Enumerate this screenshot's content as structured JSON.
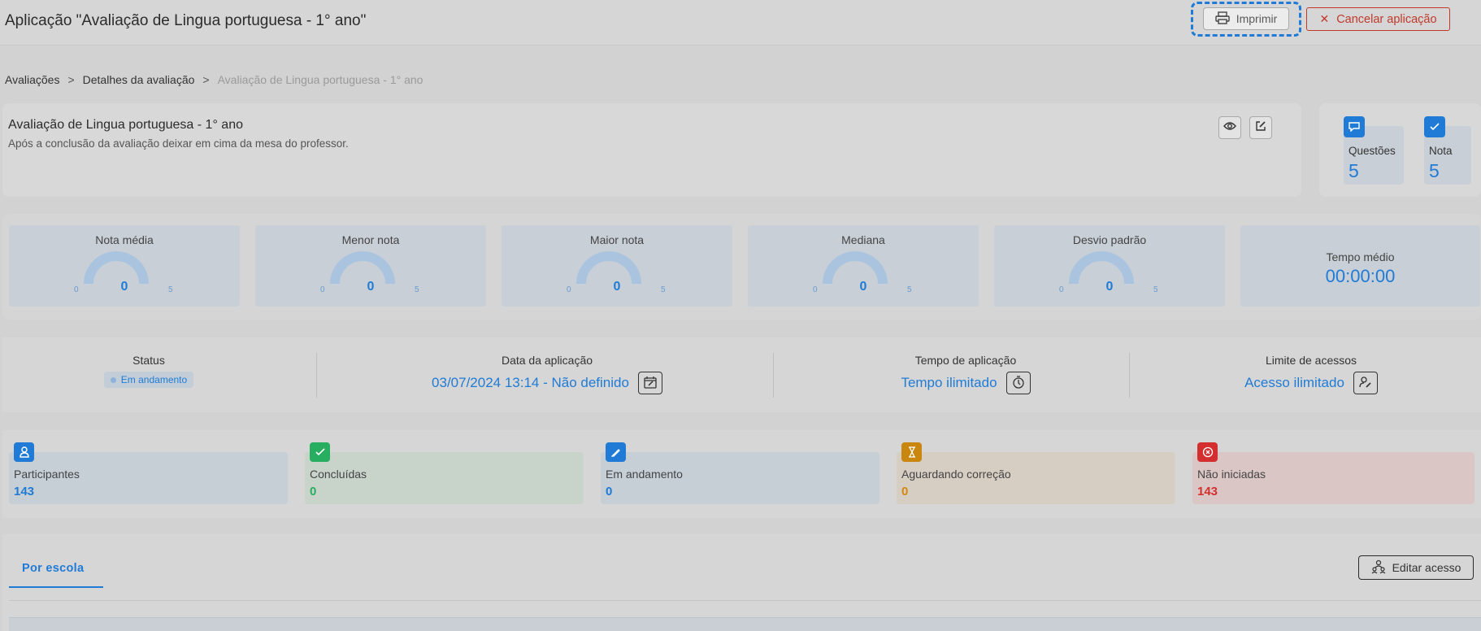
{
  "header": {
    "title": "Aplicação \"Avaliação de Lingua portuguesa - 1° ano\"",
    "print_label": "Imprimir",
    "cancel_label": "Cancelar aplicação"
  },
  "breadcrumb": {
    "items": [
      "Avaliações",
      "Detalhes da avaliação",
      "Avaliação de Lingua portuguesa - 1° ano"
    ]
  },
  "assessment": {
    "title": "Avaliação de Lingua portuguesa - 1° ano",
    "description": "Após a conclusão da avaliação deixar em cima da mesa do professor."
  },
  "summary": {
    "questions_label": "Questões",
    "questions_value": "5",
    "grade_label": "Nota",
    "grade_value": "5"
  },
  "gauges": [
    {
      "title": "Nota média",
      "value": "0",
      "min": "0",
      "max": "5"
    },
    {
      "title": "Menor nota",
      "value": "0",
      "min": "0",
      "max": "5"
    },
    {
      "title": "Maior nota",
      "value": "0",
      "min": "0",
      "max": "5"
    },
    {
      "title": "Mediana",
      "value": "0",
      "min": "0",
      "max": "5"
    },
    {
      "title": "Desvio padrão",
      "value": "0",
      "min": "0",
      "max": "5"
    }
  ],
  "average_time": {
    "title": "Tempo médio",
    "value": "00:00:00"
  },
  "status": {
    "status_title": "Status",
    "status_value": "Em andamento",
    "date_title": "Data da aplicação",
    "date_value": "03/07/2024 13:14 - Não definido",
    "time_title": "Tempo de aplicação",
    "time_value": "Tempo ilimitado",
    "access_title": "Limite de acessos",
    "access_value": "Acesso ilimitado"
  },
  "counts": [
    {
      "label": "Participantes",
      "value": "143",
      "color": "#1f7bd6"
    },
    {
      "label": "Concluídas",
      "value": "0",
      "color": "#27ae60"
    },
    {
      "label": "Em andamento",
      "value": "0",
      "color": "#1f7bd6"
    },
    {
      "label": "Aguardando correção",
      "value": "0",
      "color": "#d4880f"
    },
    {
      "label": "Não iniciadas",
      "value": "143",
      "color": "#d32f2f"
    }
  ],
  "tabs": {
    "active": "Por escola",
    "edit_access_label": "Editar acesso"
  }
}
